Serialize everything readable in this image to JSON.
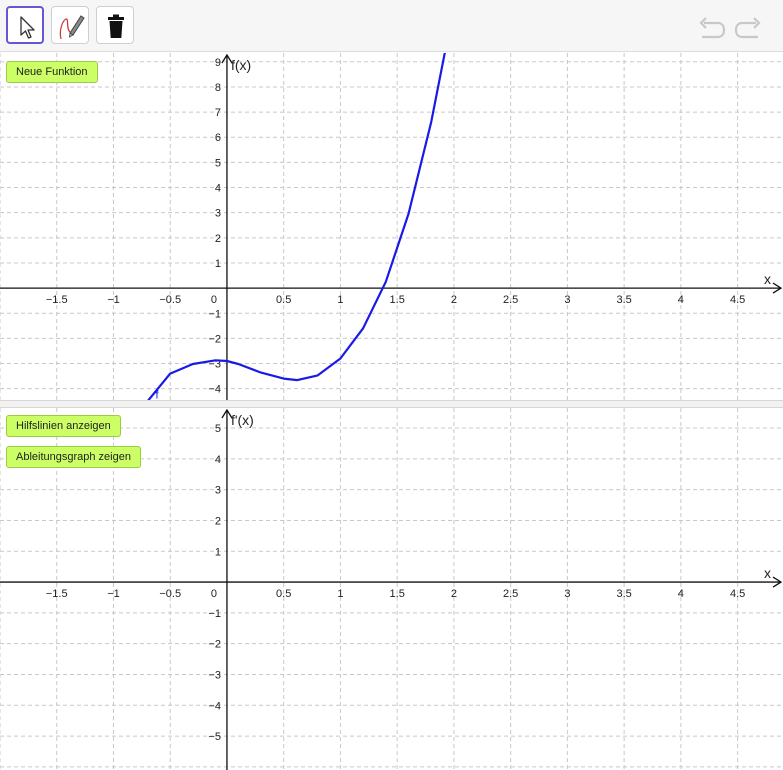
{
  "toolbar": {
    "tools": [
      {
        "icon": "pointer-arrow-icon",
        "active": true
      },
      {
        "icon": "pen-icon",
        "active": false
      },
      {
        "icon": "trash-icon",
        "active": false
      }
    ],
    "history": {
      "undo_icon": "undo-icon",
      "redo_icon": "redo-icon",
      "enabled": false
    }
  },
  "top_panel": {
    "button_label": "Neue Funktion",
    "x_axis_label": "x",
    "y_axis_label": "f(x)"
  },
  "bottom_panel": {
    "button_hilfslinien": "Hilfslinien anzeigen",
    "button_ableitung": "Ableitungsgraph zeigen",
    "x_axis_label": "x",
    "y_axis_label": "f'(x)"
  },
  "colors": {
    "curve": "#1a1ae6",
    "button_bg": "#ccff66",
    "grid": "#c8c8c8",
    "selected_tool": "#6557d2"
  },
  "chart_data": [
    {
      "type": "line",
      "name": "function-graph",
      "x_ticks": [
        -1.5,
        -1,
        -0.5,
        0,
        0.5,
        1,
        1.5,
        2,
        2.5,
        3,
        3.5,
        4,
        4.5
      ],
      "x_tick_labels": [
        "−1.5",
        "−1",
        "−0.5",
        "0",
        "0.5",
        "1",
        "1.5",
        "2",
        "2.5",
        "3",
        "3.5",
        "4",
        "4.5"
      ],
      "y_ticks": [
        -4,
        -3,
        -2,
        -1,
        1,
        2,
        3,
        4,
        5,
        6,
        7,
        8,
        9
      ],
      "y_tick_labels": [
        "−4",
        "−3",
        "−2",
        "−1",
        "1",
        "2",
        "3",
        "4",
        "5",
        "6",
        "7",
        "8",
        "9"
      ],
      "xlim": [
        -2.0,
        4.9
      ],
      "ylim": [
        -4.45,
        9.35
      ],
      "grid": true,
      "point_label": "f",
      "series": [
        {
          "name": "f",
          "x": [
            -0.7,
            -0.5,
            -0.3,
            -0.1,
            0,
            0.1,
            0.3,
            0.5,
            0.62,
            0.8,
            1.0,
            1.2,
            1.4,
            1.6,
            1.8,
            1.93
          ],
          "y": [
            -4.5,
            -3.4,
            -3.02,
            -2.87,
            -2.9,
            -3.02,
            -3.36,
            -3.6,
            -3.66,
            -3.47,
            -2.8,
            -1.6,
            0.25,
            2.95,
            6.6,
            9.6
          ]
        }
      ]
    },
    {
      "type": "line",
      "name": "derivative-graph",
      "x_ticks": [
        -1.5,
        -1,
        -0.5,
        0,
        0.5,
        1,
        1.5,
        2,
        2.5,
        3,
        3.5,
        4,
        4.5
      ],
      "x_tick_labels": [
        "−1.5",
        "−1",
        "−0.5",
        "0",
        "0.5",
        "1",
        "1.5",
        "2",
        "2.5",
        "3",
        "3.5",
        "4",
        "4.5"
      ],
      "y_ticks": [
        -5,
        -4,
        -3,
        -2,
        -1,
        1,
        2,
        3,
        4,
        5
      ],
      "y_tick_labels": [
        "−5",
        "−4",
        "−3",
        "−2",
        "−1",
        "1",
        "2",
        "3",
        "4",
        "5"
      ],
      "xlim": [
        -2.0,
        4.9
      ],
      "ylim": [
        -6.1,
        5.65
      ],
      "grid": true,
      "series": []
    }
  ]
}
